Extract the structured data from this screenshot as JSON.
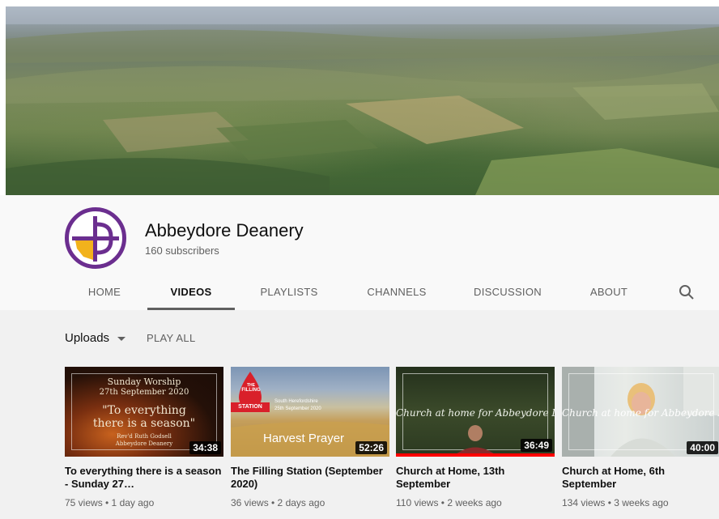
{
  "channel": {
    "name": "Abbeydore Deanery",
    "subscribers": "160 subscribers",
    "brand_color": "#6b2e8f",
    "avatar_accent": "#f2b21c"
  },
  "tabs": [
    {
      "label": "HOME",
      "active": false
    },
    {
      "label": "VIDEOS",
      "active": true
    },
    {
      "label": "PLAYLISTS",
      "active": false
    },
    {
      "label": "CHANNELS",
      "active": false
    },
    {
      "label": "DISCUSSION",
      "active": false
    },
    {
      "label": "ABOUT",
      "active": false
    }
  ],
  "search_icon": "search-icon",
  "toolbar": {
    "uploads_label": "Uploads",
    "play_all_label": "PLAY ALL"
  },
  "videos": [
    {
      "title": "To everything there is a season - Sunday 27…",
      "meta": "75 views • 1 day ago",
      "duration": "34:38",
      "thumb_lines": [
        "Sunday Worship",
        "27th September 2020",
        "\"To everything",
        "there is a season\"",
        "Rev'd Ruth Godsell",
        "Abbeydore Deanery"
      ]
    },
    {
      "title": "The Filling Station (September 2020)",
      "meta": "36 views • 2 days ago",
      "duration": "52:26",
      "thumb_lines": [
        "THE",
        "FILLING",
        "STATION",
        "South Herefordshire",
        "25th September 2020",
        "Harvest Prayer"
      ]
    },
    {
      "title": "Church at Home, 13th September",
      "meta": "110 views • 2 weeks ago",
      "duration": "36:49",
      "thumb_lines": [
        "Church at home for Abbeydore Deanery"
      ],
      "watched_fraction": 1.0
    },
    {
      "title": "Church at Home, 6th September",
      "meta": "134 views • 3 weeks ago",
      "duration": "40:00",
      "thumb_lines": [
        "Church at home for Abbeydore Deanery"
      ]
    }
  ]
}
